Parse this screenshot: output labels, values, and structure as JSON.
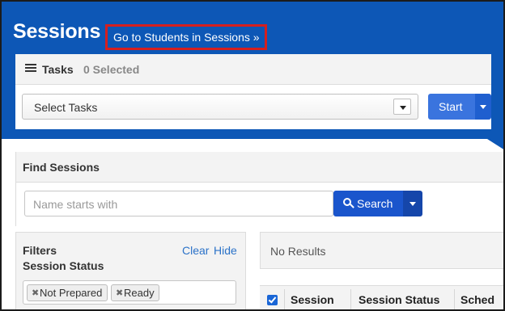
{
  "header": {
    "title": "Sessions",
    "goto_link": "Go to Students in Sessions »"
  },
  "tasks": {
    "title": "Tasks",
    "selected_count": "0 Selected",
    "select_placeholder": "Select Tasks",
    "start_label": "Start"
  },
  "find_sessions": {
    "title": "Find Sessions",
    "search_placeholder": "Name starts with",
    "search_label": "Search"
  },
  "filters": {
    "title": "Filters",
    "clear_label": "Clear",
    "hide_label": "Hide",
    "session_status_label": "Session Status",
    "chips": [
      "Not Prepared",
      "Ready"
    ]
  },
  "results": {
    "message": "No Results",
    "columns": [
      "Session",
      "Session Status",
      "Sched"
    ]
  },
  "colors": {
    "header_blue": "#0d57b6",
    "highlight_red": "#d51f1f",
    "button_blue": "#3a74de",
    "link_blue": "#2b72c8"
  }
}
